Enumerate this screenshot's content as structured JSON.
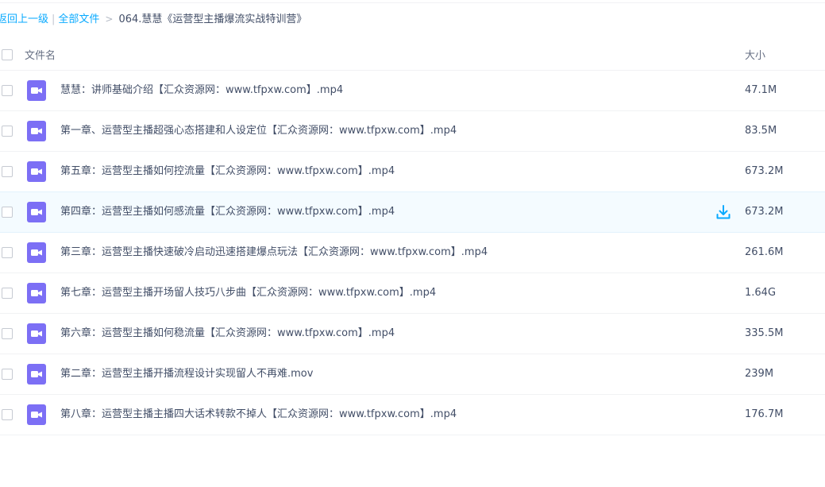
{
  "breadcrumb": {
    "back": "返回上一级",
    "separator": "|",
    "all_files": "全部文件",
    "arrow": ">",
    "current": "064.慧慧《运营型主播爆流实战特训营》"
  },
  "header": {
    "name": "文件名",
    "size": "大小"
  },
  "colors": {
    "accent": "#09aaff",
    "video_icon": "#7c6ff5",
    "hover_row": "#f4fbff"
  },
  "files": [
    {
      "name": "慧慧：讲师基础介绍【汇众资源网：www.tfpxw.com】.mp4",
      "size": "47.1M",
      "icon": "video-file-icon"
    },
    {
      "name": "第一章、运营型主播超强心态搭建和人设定位【汇众资源网：www.tfpxw.com】.mp4",
      "size": "83.5M",
      "icon": "video-file-icon"
    },
    {
      "name": "第五章：运营型主播如何控流量【汇众资源网：www.tfpxw.com】.mp4",
      "size": "673.2M",
      "icon": "video-file-icon"
    },
    {
      "name": "第四章：运营型主播如何感流量【汇众资源网：www.tfpxw.com】.mp4",
      "size": "673.2M",
      "icon": "video-file-icon"
    },
    {
      "name": "第三章：运营型主播快速破冷启动迅速搭建爆点玩法【汇众资源网：www.tfpxw.com】.mp4",
      "size": "261.6M",
      "icon": "video-file-icon"
    },
    {
      "name": "第七章：运营型主播开场留人技巧八步曲【汇众资源网：www.tfpxw.com】.mp4",
      "size": "1.64G",
      "icon": "video-file-icon"
    },
    {
      "name": "第六章：运营型主播如何稳流量【汇众资源网：www.tfpxw.com】.mp4",
      "size": "335.5M",
      "icon": "video-file-icon"
    },
    {
      "name": "第二章：运营型主播开播流程设计实现留人不再难.mov",
      "size": "239M",
      "icon": "video-file-icon"
    },
    {
      "name": "第八章：运营型主播主播四大话术转款不掉人【汇众资源网：www.tfpxw.com】.mp4",
      "size": "176.7M",
      "icon": "video-file-icon"
    }
  ]
}
